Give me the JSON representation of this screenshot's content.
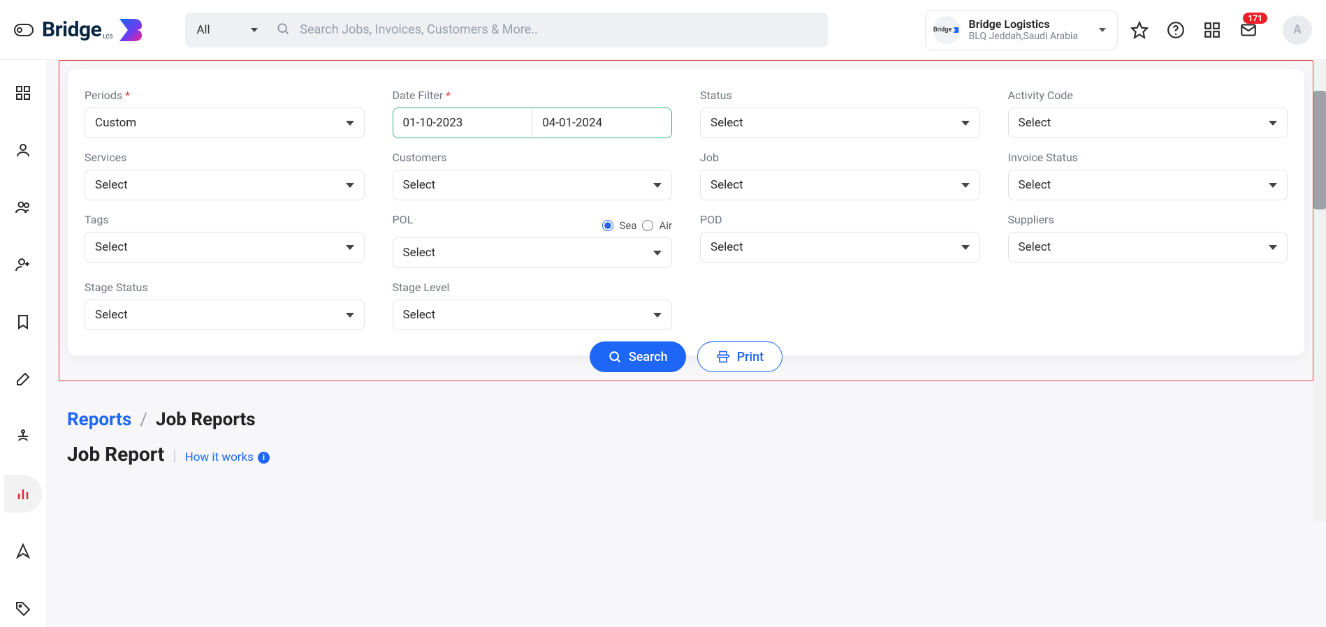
{
  "topbar": {
    "search_filter_label": "All",
    "search_placeholder": "Search Jobs, Invoices, Customers & More..",
    "tenant_name": "Bridge Logistics",
    "tenant_sub": "BLQ Jeddah,Saudi Arabia",
    "tenant_avatar_text": "Bridge",
    "notif_count": "171",
    "user_initial": "A",
    "logo_text": "Bridge",
    "logo_sub": "LCS"
  },
  "filters": {
    "periods_label": "Periods",
    "periods_value": "Custom",
    "date_filter_label": "Date Filter",
    "date_from": "01-10-2023",
    "date_to": "04-01-2024",
    "status_label": "Status",
    "status_value": "Select",
    "activity_label": "Activity Code",
    "activity_value": "Select",
    "services_label": "Services",
    "services_value": "Select",
    "customers_label": "Customers",
    "customers_value": "Select",
    "job_label": "Job",
    "job_value": "Select",
    "invoice_status_label": "Invoice Status",
    "invoice_status_value": "Select",
    "tags_label": "Tags",
    "tags_value": "Select",
    "pol_label": "POL",
    "pol_value": "Select",
    "pol_mode_sea": "Sea",
    "pol_mode_air": "Air",
    "pod_label": "POD",
    "pod_value": "Select",
    "suppliers_label": "Suppliers",
    "suppliers_value": "Select",
    "stage_status_label": "Stage Status",
    "stage_status_value": "Select",
    "stage_level_label": "Stage Level",
    "stage_level_value": "Select"
  },
  "actions": {
    "search": "Search",
    "print": "Print"
  },
  "crumbs": {
    "root": "Reports",
    "sep": "/",
    "leaf": "Job Reports"
  },
  "heading": {
    "title": "Job Report",
    "how_it_works": "How it works",
    "info_glyph": "i"
  }
}
